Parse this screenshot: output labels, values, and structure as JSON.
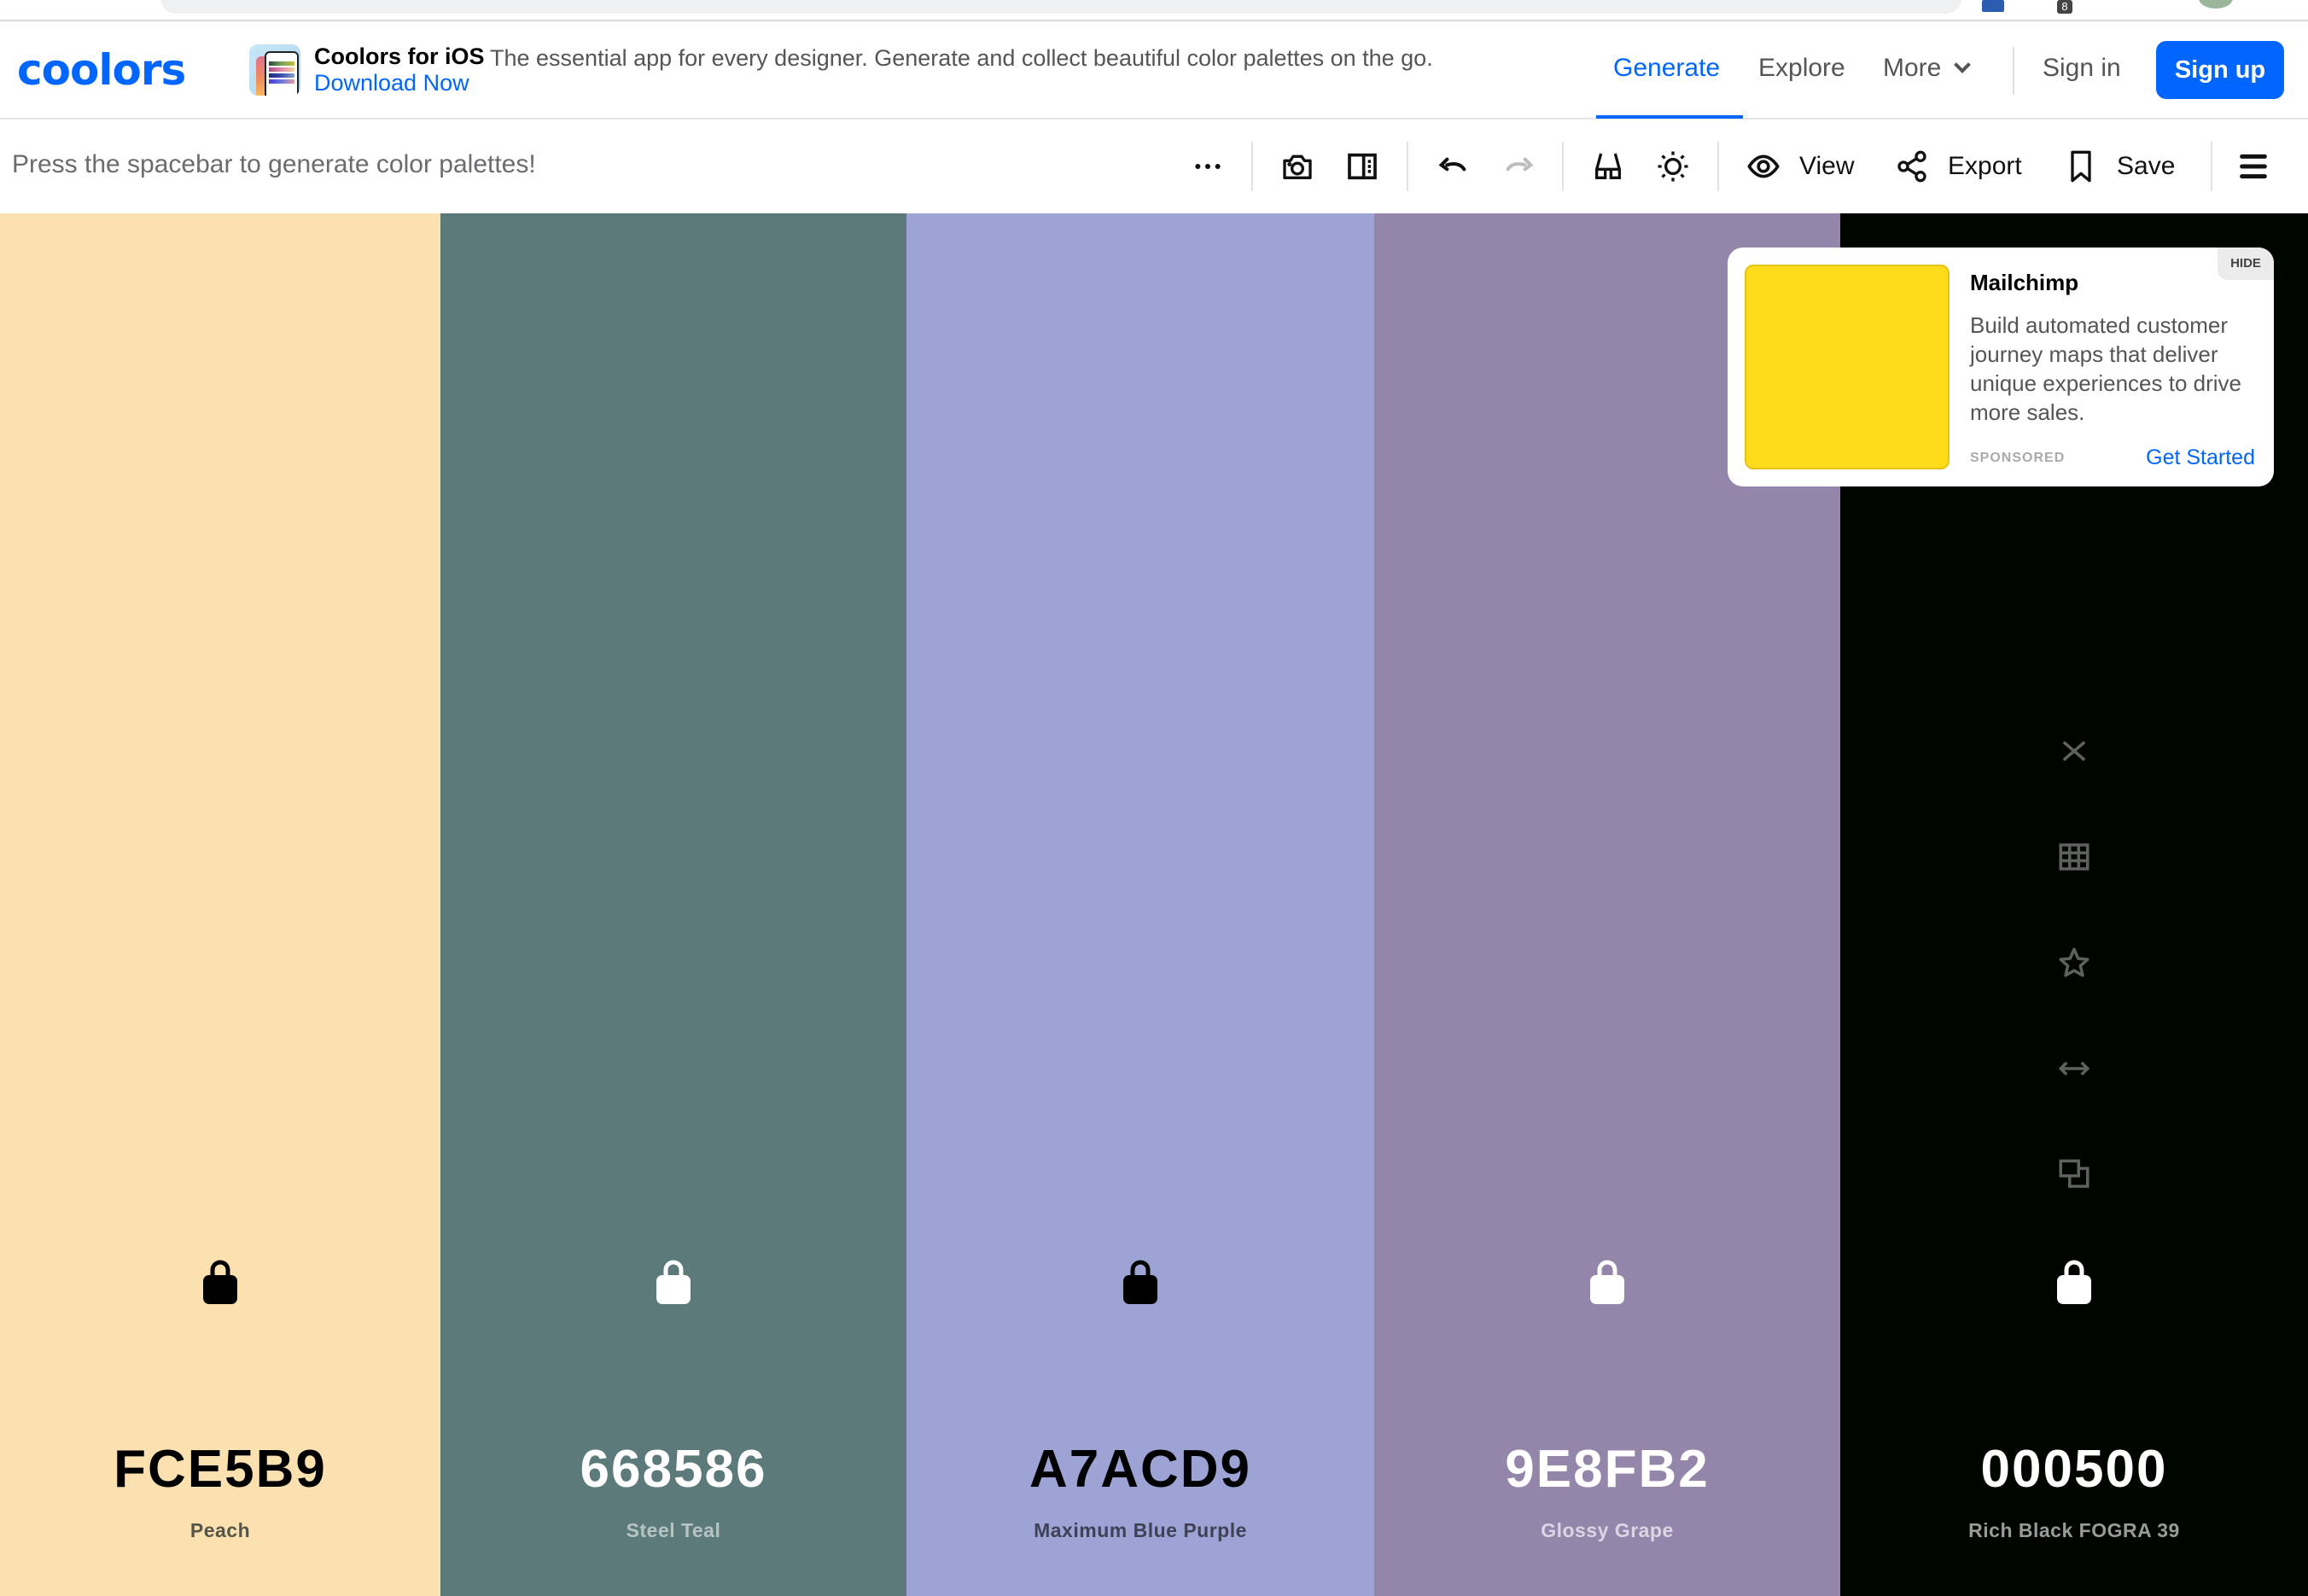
{
  "browser": {
    "extension_badge": "8"
  },
  "header": {
    "logo": "coolors",
    "promo": {
      "title": "Coolors for iOS",
      "description": "The essential app for every designer. Generate and collect beautiful color palettes on the go.",
      "link": "Download Now"
    },
    "nav": [
      {
        "label": "Generate",
        "active": true
      },
      {
        "label": "Explore",
        "active": false
      },
      {
        "label": "More",
        "active": false
      }
    ],
    "sign_in": "Sign in",
    "sign_up": "Sign up"
  },
  "toolbar": {
    "hint": "Press the spacebar to generate color palettes!",
    "buttons": [
      {
        "icon": "more-horizontal-icon"
      },
      {
        "icon": "camera-icon"
      },
      {
        "icon": "sidebar-panel-icon"
      },
      {
        "icon": "undo-icon"
      },
      {
        "icon": "redo-icon",
        "disabled": true
      },
      {
        "icon": "glasses-icon"
      },
      {
        "icon": "sun-icon"
      },
      {
        "icon": "eye-icon",
        "label": "View"
      },
      {
        "icon": "share-icon",
        "label": "Export"
      },
      {
        "icon": "bookmark-icon",
        "label": "Save"
      },
      {
        "icon": "menu-icon"
      }
    ]
  },
  "palette": {
    "colors": [
      {
        "hex": "FCE5B9",
        "name": "Peach",
        "swatch": "#fbe0b0",
        "text": "#000000",
        "subtext": "#555548",
        "locked": false
      },
      {
        "hex": "668586",
        "name": "Steel Teal",
        "swatch": "#5d7a7b",
        "text": "#ffffff",
        "subtext": "#b7c4c4",
        "locked": false
      },
      {
        "hex": "A7ACD9",
        "name": "Maximum Blue Purple",
        "swatch": "#9da3d4",
        "text": "#000000",
        "subtext": "#3f4256",
        "locked": false
      },
      {
        "hex": "9E8FB2",
        "name": "Glossy Grape",
        "swatch": "#9485aa",
        "text": "#ffffff",
        "subtext": "#dcd6e4",
        "locked": false
      },
      {
        "hex": "000500",
        "name": "Rich Black FOGRA 39",
        "swatch": "#000500",
        "text": "#ffffff",
        "subtext": "#9a9a9a",
        "locked": false
      }
    ],
    "hover_tools": [
      "close-icon",
      "grid-icon",
      "star-icon",
      "drag-arrows-icon",
      "copy-icon"
    ]
  },
  "ad": {
    "title": "Mailchimp",
    "body": "Build automated customer journey maps that deliver unique experiences to drive more sales.",
    "sponsored": "SPONSORED",
    "cta": "Get Started",
    "hide": "HIDE",
    "image_color": "#fddb18"
  },
  "colors": {
    "accent": "#0066ff"
  }
}
